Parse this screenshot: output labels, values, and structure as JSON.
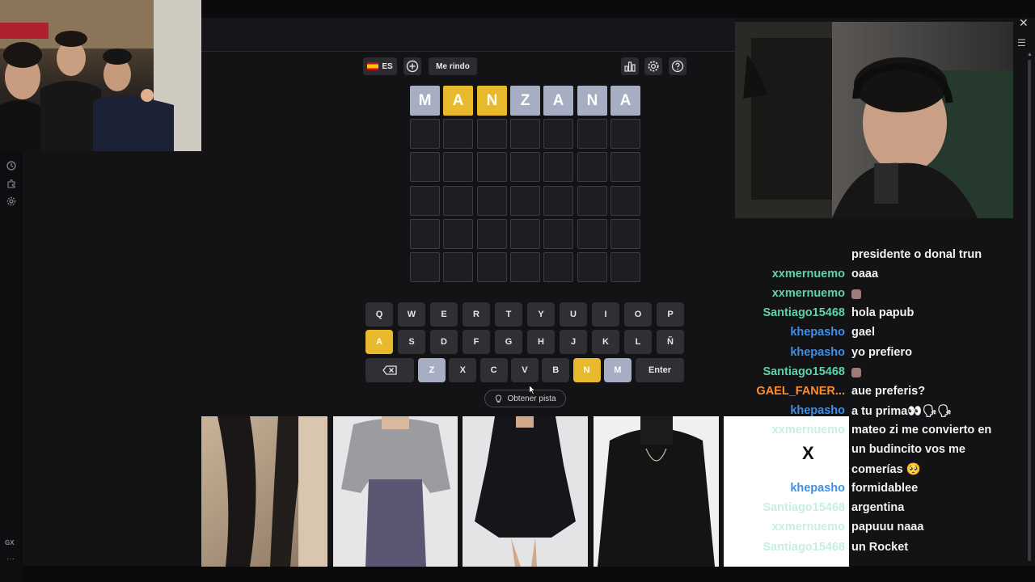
{
  "toolbar": {
    "language_code": "ES",
    "surrender_label": "Me rindo"
  },
  "grid": {
    "rows": [
      [
        {
          "l": "M",
          "s": "gray"
        },
        {
          "l": "A",
          "s": "yellow"
        },
        {
          "l": "N",
          "s": "yellow"
        },
        {
          "l": "Z",
          "s": "gray"
        },
        {
          "l": "A",
          "s": "gray"
        },
        {
          "l": "N",
          "s": "gray"
        },
        {
          "l": "A",
          "s": "gray"
        }
      ],
      [
        {
          "l": "",
          "s": "empty"
        },
        {
          "l": "",
          "s": "empty"
        },
        {
          "l": "",
          "s": "empty"
        },
        {
          "l": "",
          "s": "empty"
        },
        {
          "l": "",
          "s": "empty"
        },
        {
          "l": "",
          "s": "empty"
        },
        {
          "l": "",
          "s": "empty"
        }
      ],
      [
        {
          "l": "",
          "s": "empty"
        },
        {
          "l": "",
          "s": "empty"
        },
        {
          "l": "",
          "s": "empty"
        },
        {
          "l": "",
          "s": "empty"
        },
        {
          "l": "",
          "s": "empty"
        },
        {
          "l": "",
          "s": "empty"
        },
        {
          "l": "",
          "s": "empty"
        }
      ],
      [
        {
          "l": "",
          "s": "empty"
        },
        {
          "l": "",
          "s": "empty"
        },
        {
          "l": "",
          "s": "empty"
        },
        {
          "l": "",
          "s": "empty"
        },
        {
          "l": "",
          "s": "empty"
        },
        {
          "l": "",
          "s": "empty"
        },
        {
          "l": "",
          "s": "empty"
        }
      ],
      [
        {
          "l": "",
          "s": "empty"
        },
        {
          "l": "",
          "s": "empty"
        },
        {
          "l": "",
          "s": "empty"
        },
        {
          "l": "",
          "s": "empty"
        },
        {
          "l": "",
          "s": "empty"
        },
        {
          "l": "",
          "s": "empty"
        },
        {
          "l": "",
          "s": "empty"
        }
      ],
      [
        {
          "l": "",
          "s": "empty"
        },
        {
          "l": "",
          "s": "empty"
        },
        {
          "l": "",
          "s": "empty"
        },
        {
          "l": "",
          "s": "empty"
        },
        {
          "l": "",
          "s": "empty"
        },
        {
          "l": "",
          "s": "empty"
        },
        {
          "l": "",
          "s": "empty"
        }
      ]
    ]
  },
  "keyboard": {
    "row1": [
      {
        "k": "Q",
        "s": "n"
      },
      {
        "k": "W",
        "s": "n"
      },
      {
        "k": "E",
        "s": "n"
      },
      {
        "k": "R",
        "s": "n"
      },
      {
        "k": "T",
        "s": "n"
      },
      {
        "k": "Y",
        "s": "n"
      },
      {
        "k": "U",
        "s": "n"
      },
      {
        "k": "I",
        "s": "n"
      },
      {
        "k": "O",
        "s": "n"
      },
      {
        "k": "P",
        "s": "n"
      }
    ],
    "row2": [
      {
        "k": "A",
        "s": "yellow"
      },
      {
        "k": "S",
        "s": "n"
      },
      {
        "k": "D",
        "s": "n"
      },
      {
        "k": "F",
        "s": "n"
      },
      {
        "k": "G",
        "s": "n"
      },
      {
        "k": "H",
        "s": "n"
      },
      {
        "k": "J",
        "s": "n"
      },
      {
        "k": "K",
        "s": "n"
      },
      {
        "k": "L",
        "s": "n"
      },
      {
        "k": "Ñ",
        "s": "n"
      }
    ],
    "row3": [
      {
        "k": "Z",
        "s": "gray"
      },
      {
        "k": "X",
        "s": "n"
      },
      {
        "k": "C",
        "s": "n"
      },
      {
        "k": "V",
        "s": "n"
      },
      {
        "k": "B",
        "s": "n"
      },
      {
        "k": "N",
        "s": "yellow"
      },
      {
        "k": "M",
        "s": "gray"
      }
    ],
    "enter_label": "Enter"
  },
  "hint": {
    "label": "Obtener pista"
  },
  "ad_overlay": {
    "close_label": "X"
  },
  "chat": [
    {
      "user": "",
      "msg": "presidente o donal trun",
      "color": "",
      "faded": false
    },
    {
      "user": "xxmernuemo",
      "msg": "oaaa",
      "color": "green",
      "faded": false
    },
    {
      "user": "xxmernuemo",
      "msg": "",
      "color": "green",
      "faded": false,
      "emoji": true
    },
    {
      "user": "Santiago15468",
      "msg": "hola papub",
      "color": "green",
      "faded": false
    },
    {
      "user": "khepasho",
      "msg": "gael",
      "color": "blue",
      "faded": false
    },
    {
      "user": "khepasho",
      "msg": "yo prefiero",
      "color": "blue",
      "faded": false
    },
    {
      "user": "Santiago15468",
      "msg": "",
      "color": "green",
      "faded": false,
      "emoji": true
    },
    {
      "user": "GAEL_FANER...",
      "msg": "aue preferis?",
      "color": "orange",
      "faded": false
    },
    {
      "user": "khepasho",
      "msg": "a tu prima👀🗣🗣",
      "color": "blue",
      "faded": false
    },
    {
      "user": "xxmernuemo",
      "msg": "mateo zi me convierto en",
      "color": "green",
      "faded": true
    },
    {
      "user": "",
      "msg": "un budincito vos me",
      "color": "",
      "faded": false
    },
    {
      "user": "",
      "msg": "comerías 🥺",
      "color": "",
      "faded": false
    },
    {
      "user": "khepasho",
      "msg": "formidablee",
      "color": "blue",
      "faded": false
    },
    {
      "user": "Santiago15468",
      "msg": "argentina",
      "color": "green",
      "faded": true
    },
    {
      "user": "xxmernuemo",
      "msg": "papuuu naaa",
      "color": "green",
      "faded": true
    },
    {
      "user": "Santiago15468",
      "msg": "un Rocket",
      "color": "green",
      "faded": true
    }
  ],
  "sidebar": {
    "gx_label": "GX"
  }
}
